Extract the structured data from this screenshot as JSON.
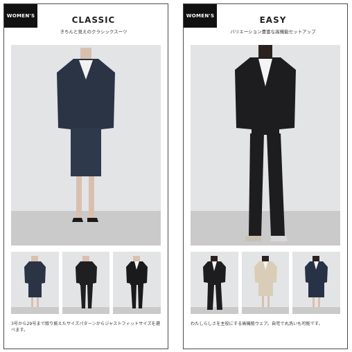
{
  "panels": [
    {
      "tag": "WOMEN'S",
      "title": "CLASSIC",
      "subtitle": "きちんと見えのクラシックスーツ",
      "description": "3号から29号まで取り揃えたサイズパターンからジャストフィットサイズを選べます。",
      "hero_image": "model-navy-skirt-suit",
      "thumbnails": [
        "navy-skirt-suit",
        "black-pants-suit",
        "black-pants-suit-white-shirt"
      ]
    },
    {
      "tag": "WOMEN'S",
      "title": "EASY",
      "subtitle": "バリエーション豊富な高機能セットアップ",
      "description": "わたしらしさを主役にする高機能ウェア。自宅で丸洗いも可能です。",
      "hero_image": "model-black-wide-pants-setup",
      "thumbnails": [
        "black-wide-pants-setup",
        "beige-skirt-setup",
        "navy-skirt-setup"
      ]
    }
  ],
  "colors": {
    "navy": "#2a3445",
    "black": "#1c1c1e",
    "beige": "#d9cdb8",
    "backdrop": "#e4e5e7",
    "floor": "#c9c9ca"
  }
}
